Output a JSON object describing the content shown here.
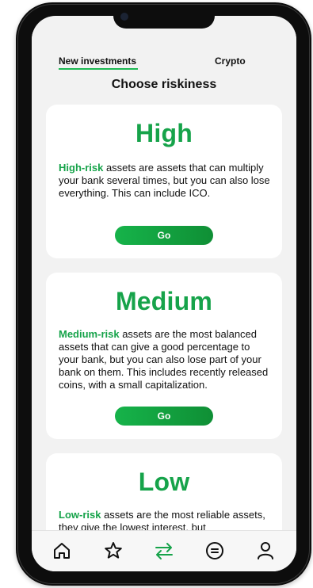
{
  "tabs": {
    "new_investments": "New investments",
    "crypto": "Crypto"
  },
  "section_title": "Choose riskiness",
  "cards": [
    {
      "title": "High",
      "accent": "High-risk",
      "text": " assets are assets that can multiply your bank several times, but you can also lose everything. This can include ICO.",
      "button": "Go"
    },
    {
      "title": "Medium",
      "accent": "Medium-risk",
      "text": " assets are the most balanced assets that can give a good percentage to your bank, but you can also lose part of your bank on them. This includes recently released coins, with a small capitalization.",
      "button": "Go"
    },
    {
      "title": "Low",
      "accent": "Low-risk",
      "text": " assets are the most reliable assets, they give the lowest interest, but"
    }
  ],
  "bottom_nav": [
    {
      "icon": "home-icon"
    },
    {
      "icon": "star-icon"
    },
    {
      "icon": "exchange-arrows-icon",
      "active": true
    },
    {
      "icon": "list-icon"
    },
    {
      "icon": "profile-icon"
    }
  ],
  "colors": {
    "accent": "#16a34a",
    "screen_bg": "#f2f2f2",
    "card_bg": "#ffffff",
    "text": "#111111"
  }
}
